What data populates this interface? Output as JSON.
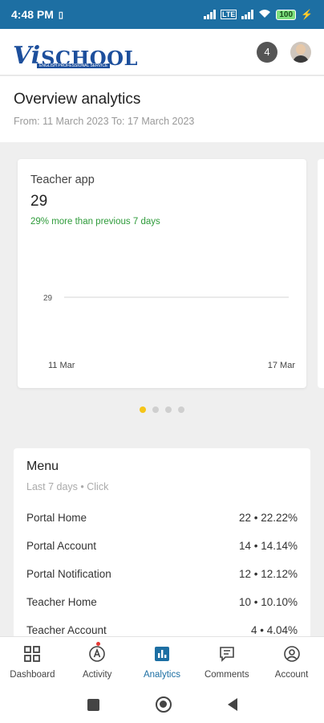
{
  "status_bar": {
    "time": "4:48 PM",
    "battery": "100"
  },
  "header": {
    "logo_vi": "Vi",
    "logo_school": "SCHOOL",
    "logo_tagline": "ENGLISH PROFESSIONAL SERVICE",
    "notification_count": "4"
  },
  "overview": {
    "title": "Overview analytics",
    "date_range": "From: 11 March 2023 To: 17 March 2023"
  },
  "carousel": {
    "active_index": 0,
    "page_count": 4,
    "card": {
      "label": "Teacher app",
      "value": "29",
      "delta": "29% more than previous 7 days"
    }
  },
  "chart_data": {
    "type": "line",
    "x": [
      "11 Mar",
      "17 Mar"
    ],
    "values": [
      29,
      29
    ],
    "y_tick_labels": [
      "29"
    ],
    "color": "#dddddd"
  },
  "menu": {
    "title": "Menu",
    "subtitle": "Last 7 days • Click",
    "rows": [
      {
        "name": "Portal Home",
        "value": "22 • 22.22%"
      },
      {
        "name": "Portal Account",
        "value": "14 • 14.14%"
      },
      {
        "name": "Portal Notification",
        "value": "12 • 12.12%"
      },
      {
        "name": "Teacher Home",
        "value": "10 • 10.10%"
      },
      {
        "name": "Teacher Account",
        "value": "4 • 4.04%"
      }
    ]
  },
  "bottom_nav": [
    {
      "label": "Dashboard",
      "icon": "dashboard-icon",
      "active": false
    },
    {
      "label": "Activity",
      "icon": "activity-icon",
      "active": false
    },
    {
      "label": "Analytics",
      "icon": "analytics-icon",
      "active": true
    },
    {
      "label": "Comments",
      "icon": "comments-icon",
      "active": false
    },
    {
      "label": "Account",
      "icon": "account-icon",
      "active": false
    }
  ],
  "colors": {
    "primary": "#1d6fa3",
    "positive": "#2e9b3a",
    "dot_active": "#f5c518"
  }
}
